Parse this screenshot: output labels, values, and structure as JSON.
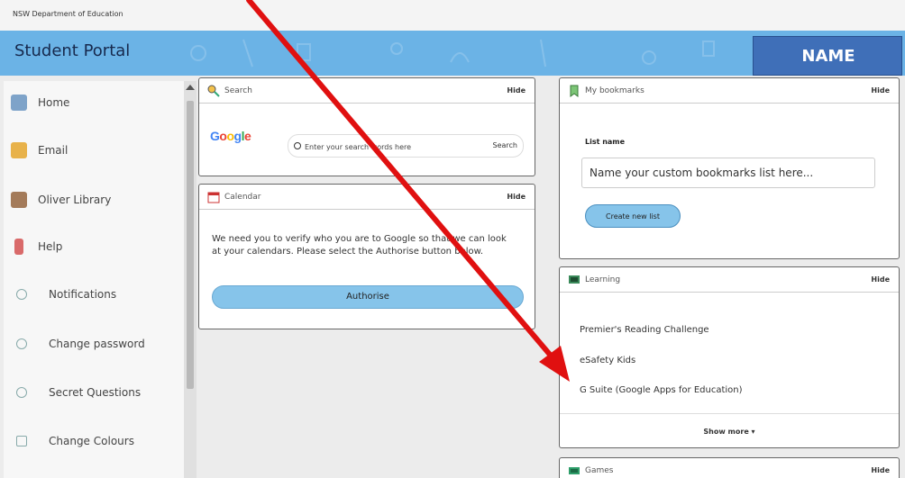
{
  "header": {
    "department": "NSW Department of Education",
    "portal_title": "Student Portal",
    "name_label": "NAME"
  },
  "sidebar": {
    "items": [
      {
        "label": "Home",
        "icon": "home-icon"
      },
      {
        "label": "Email",
        "icon": "email-icon"
      },
      {
        "label": "Oliver Library",
        "icon": "library-icon"
      },
      {
        "label": "Help",
        "icon": "help-icon"
      },
      {
        "label": "Notifications",
        "icon": "bell-icon"
      },
      {
        "label": "Change password",
        "icon": "key-icon"
      },
      {
        "label": "Secret Questions",
        "icon": "question-icon"
      },
      {
        "label": "Change Colours",
        "icon": "palette-icon"
      }
    ]
  },
  "search_panel": {
    "title": "Search",
    "hide": "Hide",
    "google": "Google",
    "placeholder": "Enter your search words here",
    "button": "Search"
  },
  "calendar_panel": {
    "title": "Calendar",
    "hide": "Hide",
    "message": "We need you to verify who you are to Google so that we can look at your calendars. Please select the Authorise button below.",
    "button": "Authorise"
  },
  "bookmarks_panel": {
    "title": "My bookmarks",
    "hide": "Hide",
    "list_label": "List name",
    "placeholder": "Name your custom bookmarks list here...",
    "button": "Create new list"
  },
  "learning_panel": {
    "title": "Learning",
    "hide": "Hide",
    "links": [
      "Premier's Reading Challenge",
      "eSafety Kids",
      "G Suite (Google Apps for Education)"
    ],
    "show_more": "Show more ▾"
  },
  "games_panel": {
    "title": "Games",
    "hide": "Hide"
  },
  "colors": {
    "banner": "#6bb3e6",
    "name_box": "#3f6fb8",
    "button": "#86c4ea",
    "arrow": "#e01010"
  }
}
